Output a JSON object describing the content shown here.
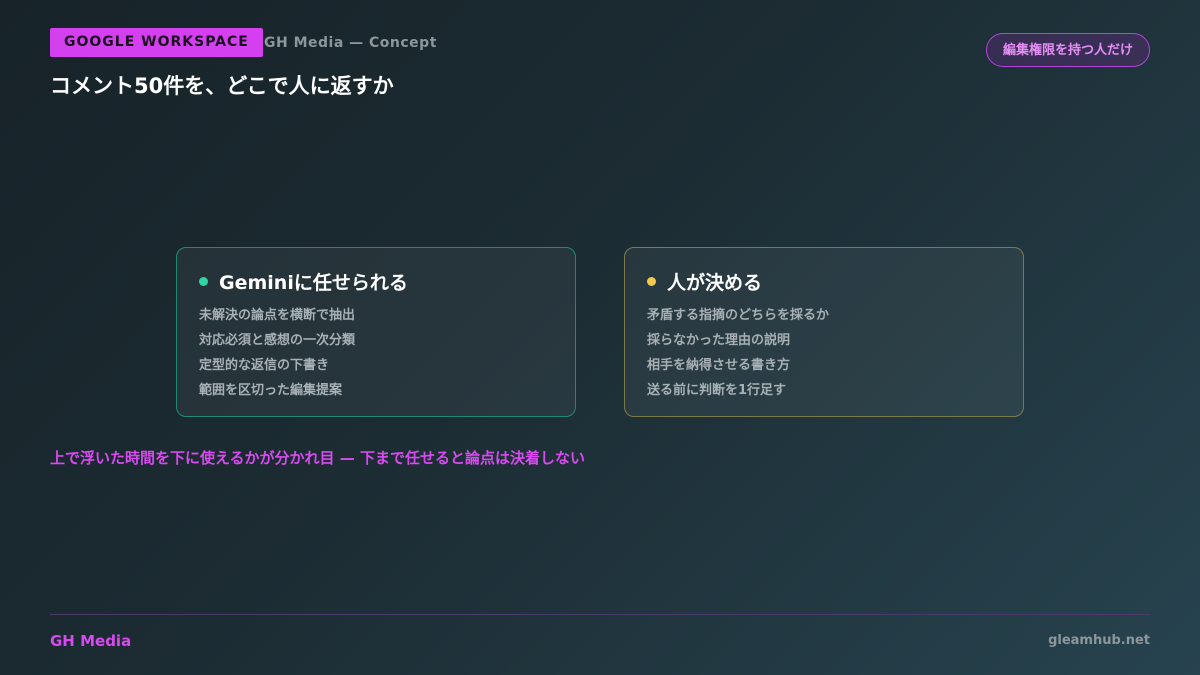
{
  "header": {
    "tag": "GOOGLE WORKSPACE",
    "subtitle": "GH Media — Concept",
    "badge": "編集権限を持つ人だけ",
    "title": "コメント50件を、どこで人に返すか"
  },
  "cards": [
    {
      "title": "Geminiに任せられる",
      "dot_color": "#2ed6a4",
      "items": [
        "未解決の論点を横断で抽出",
        "対応必須と感想の一次分類",
        "定型的な返信の下書き",
        "範囲を区切った編集提案"
      ]
    },
    {
      "title": "人が決める",
      "dot_color": "#f2c94c",
      "items": [
        "矛盾する指摘のどちらを採るか",
        "採らなかった理由の説明",
        "相手を納得させる書き方",
        "送る前に判断を1行足す"
      ]
    }
  ],
  "note": "上で浮いた時間を下に使えるかが分かれ目 — 下まで任せると論点は決着しない",
  "footer": {
    "brand": "GH Media",
    "site": "gleamhub.net"
  },
  "colors": {
    "accent": "#d43ff0",
    "green": "#2ed6a4",
    "yellow": "#f2c94c"
  }
}
